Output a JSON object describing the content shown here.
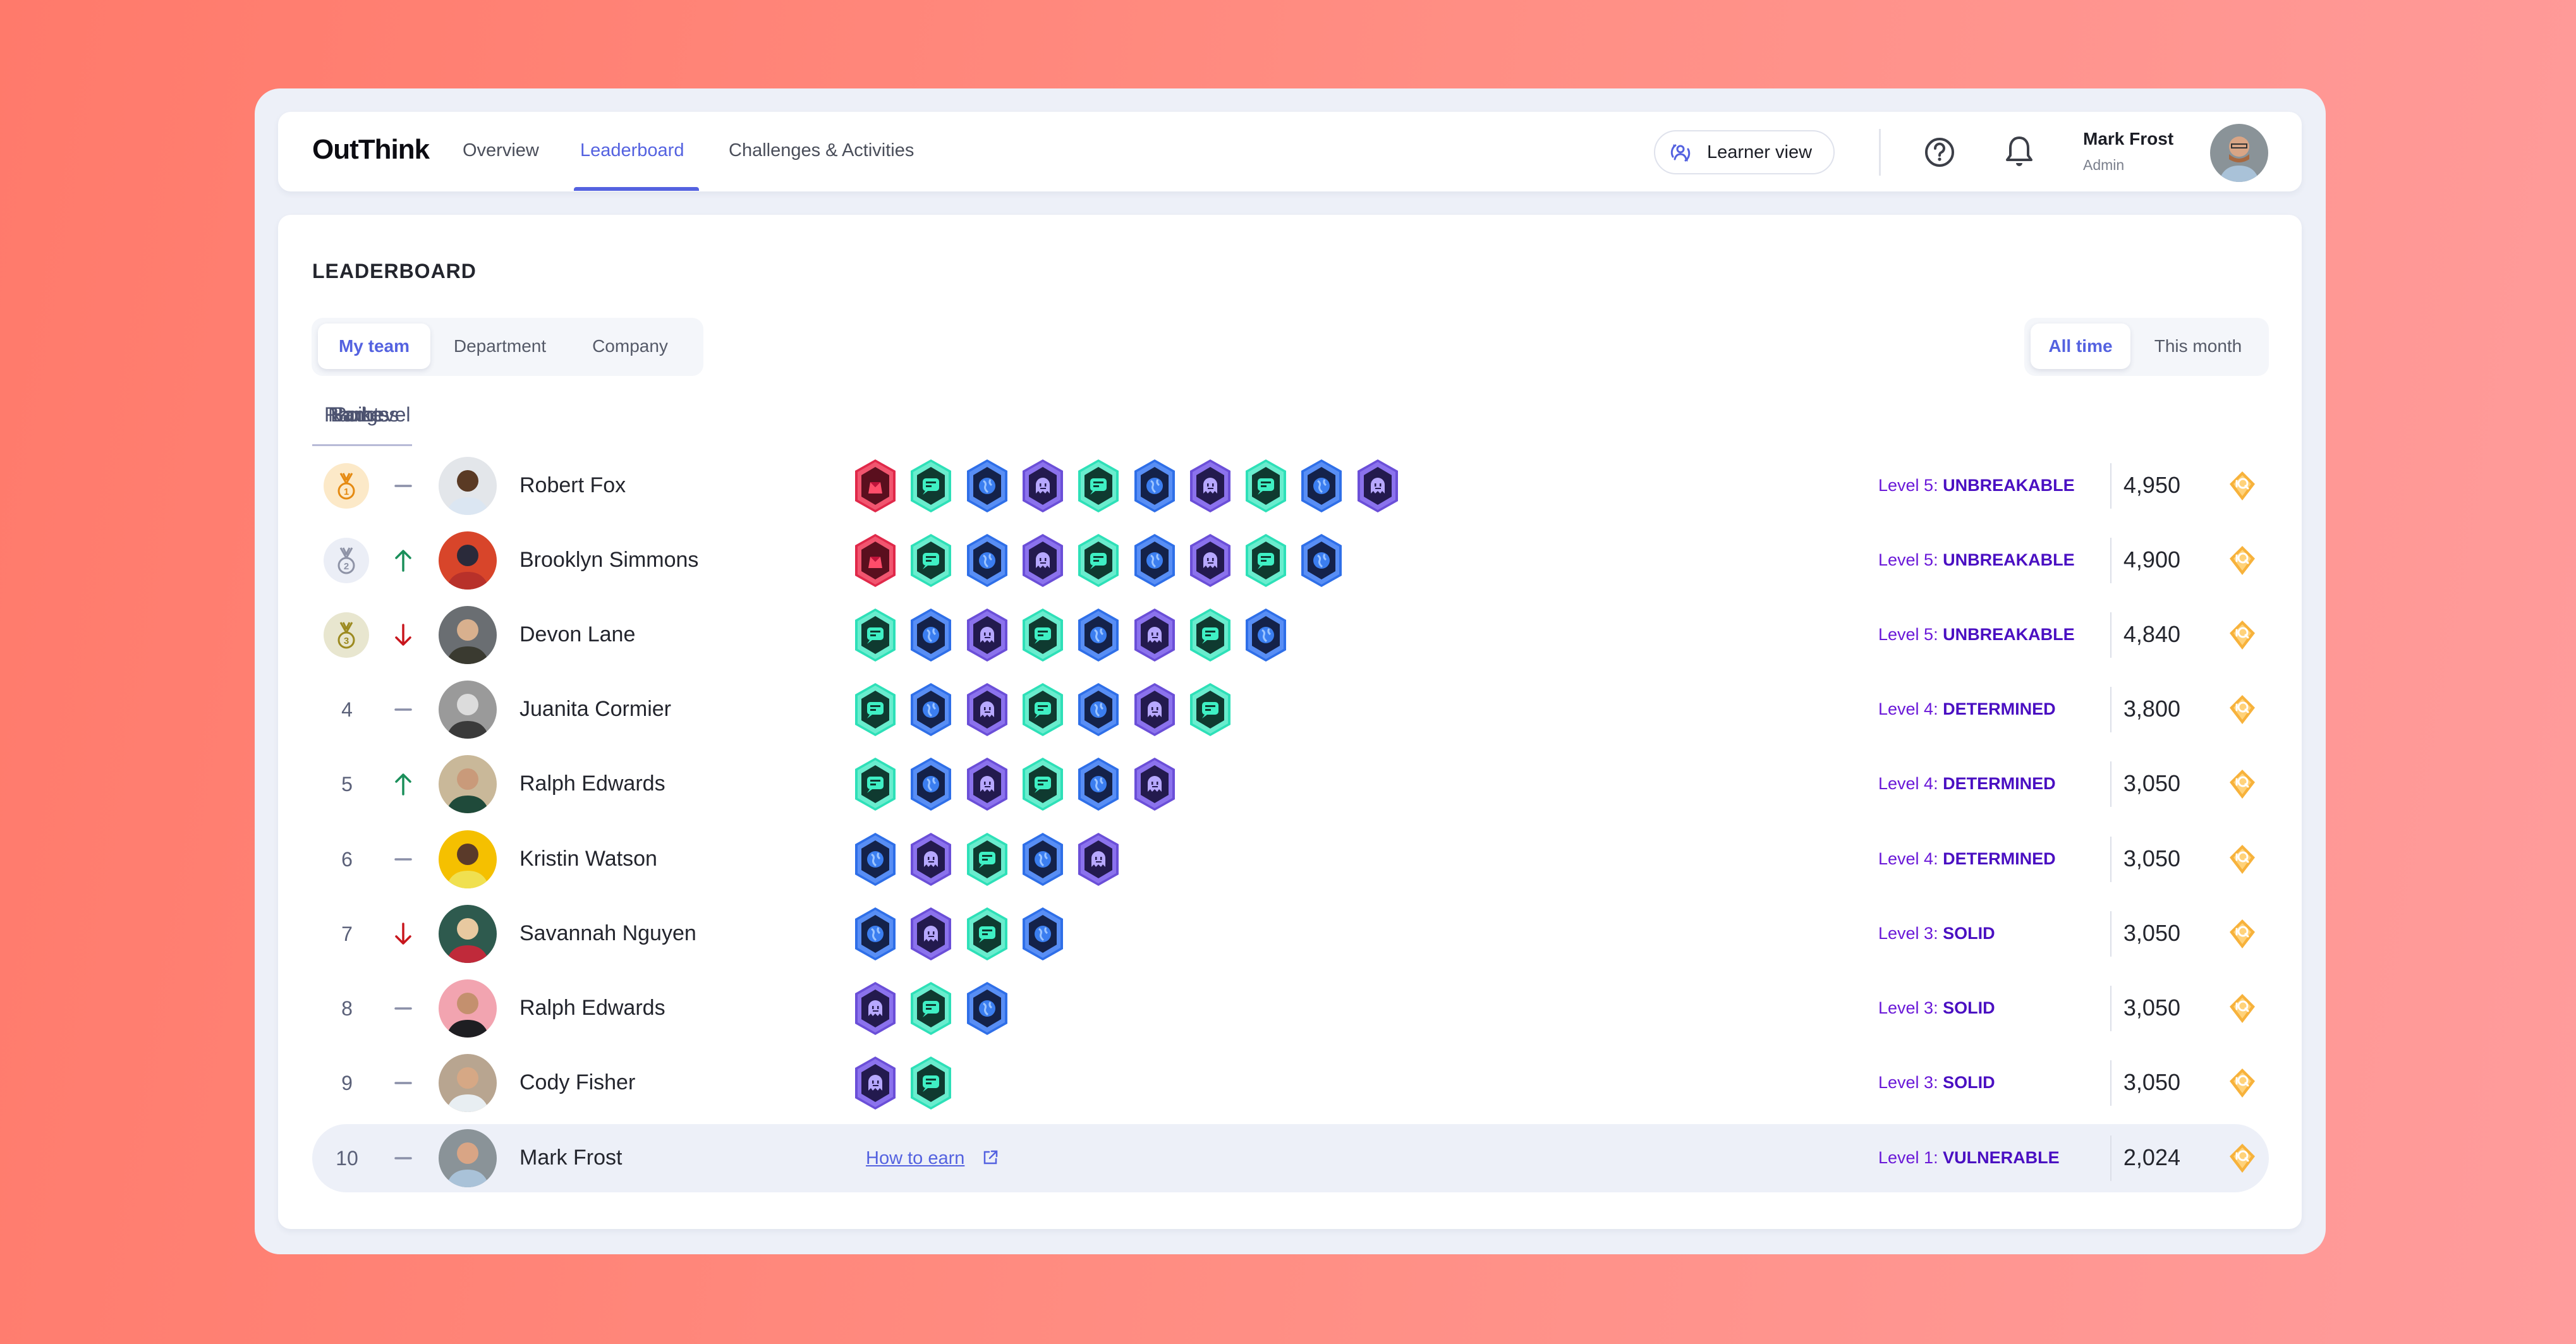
{
  "app": {
    "title": "OutThink"
  },
  "nav": {
    "items": [
      {
        "label": "Overview",
        "active": false
      },
      {
        "label": "Leaderboard",
        "active": true
      },
      {
        "label": "Challenges & Activities",
        "active": false
      }
    ]
  },
  "header": {
    "learner_view_label": "Learner view",
    "user_name": "Mark Frost",
    "user_role": "Admin"
  },
  "leaderboard": {
    "title": "LEADERBOARD",
    "scope_tabs": [
      {
        "label": "My team",
        "active": true
      },
      {
        "label": "Department",
        "active": false
      },
      {
        "label": "Company",
        "active": false
      }
    ],
    "period_tabs": [
      {
        "label": "All time",
        "active": true
      },
      {
        "label": "This month",
        "active": false
      }
    ],
    "column_headers": [
      "Rank",
      "Name",
      "Badges",
      "Points",
      "Level"
    ],
    "how_to_earn_label": "How to earn",
    "rows": [
      {
        "rank": "1",
        "medal": "gold",
        "trend": "same",
        "name": "Robert Fox",
        "badges": [
          "crown",
          "chat",
          "globe",
          "ghost",
          "chat",
          "globe",
          "ghost",
          "chat",
          "globe",
          "ghost"
        ],
        "level_prefix": "Level 5: ",
        "level_name": "UNBREAKABLE",
        "points": "4,950"
      },
      {
        "rank": "2",
        "medal": "silver",
        "trend": "up",
        "name": "Brooklyn Simmons",
        "badges": [
          "crown",
          "chat",
          "globe",
          "ghost",
          "chat",
          "globe",
          "ghost",
          "chat",
          "globe"
        ],
        "level_prefix": "Level 5: ",
        "level_name": "UNBREAKABLE",
        "points": "4,900"
      },
      {
        "rank": "3",
        "medal": "bronze",
        "trend": "down",
        "name": "Devon Lane",
        "badges": [
          "chat",
          "globe",
          "ghost",
          "chat",
          "globe",
          "ghost",
          "chat",
          "globe"
        ],
        "level_prefix": "Level 5: ",
        "level_name": "UNBREAKABLE",
        "points": "4,840"
      },
      {
        "rank": "4",
        "medal": "",
        "trend": "same",
        "name": "Juanita Cormier",
        "badges": [
          "chat",
          "globe",
          "ghost",
          "chat",
          "globe",
          "ghost",
          "chat"
        ],
        "level_prefix": "Level 4: ",
        "level_name": "DETERMINED",
        "points": "3,800"
      },
      {
        "rank": "5",
        "medal": "",
        "trend": "up",
        "name": "Ralph Edwards",
        "badges": [
          "chat",
          "globe",
          "ghost",
          "chat",
          "globe",
          "ghost"
        ],
        "level_prefix": "Level 4: ",
        "level_name": "DETERMINED",
        "points": "3,050"
      },
      {
        "rank": "6",
        "medal": "",
        "trend": "same",
        "name": "Kristin Watson",
        "badges": [
          "globe",
          "ghost",
          "chat",
          "globe",
          "ghost"
        ],
        "level_prefix": "Level 4: ",
        "level_name": "DETERMINED",
        "points": "3,050"
      },
      {
        "rank": "7",
        "medal": "",
        "trend": "down",
        "name": "Savannah Nguyen",
        "badges": [
          "globe",
          "ghost",
          "chat",
          "globe"
        ],
        "level_prefix": "Level 3: ",
        "level_name": "SOLID",
        "points": "3,050"
      },
      {
        "rank": "8",
        "medal": "",
        "trend": "same",
        "name": "Ralph Edwards",
        "badges": [
          "ghost",
          "chat",
          "globe"
        ],
        "level_prefix": "Level 3: ",
        "level_name": "SOLID",
        "points": "3,050"
      },
      {
        "rank": "9",
        "medal": "",
        "trend": "same",
        "name": "Cody Fisher",
        "badges": [
          "ghost",
          "chat"
        ],
        "level_prefix": "Level 3: ",
        "level_name": "SOLID",
        "points": "3,050"
      },
      {
        "rank": "10",
        "medal": "",
        "trend": "same",
        "name": "Mark Frost",
        "badges": [],
        "current_user": true,
        "level_prefix": "Level 1: ",
        "level_name": "VULNERABLE",
        "points": "2,024"
      }
    ]
  },
  "colors": {
    "accent": "#5462E0",
    "level_text": "#4A0FC2",
    "trend_up": "#1A8F5A",
    "trend_down": "#C8161D",
    "badge_crown": "#E0294A",
    "badge_chat": "#2EE0B8",
    "badge_globe": "#2F6FE8",
    "badge_ghost": "#6B4FD8",
    "points_icon": "#F7B23B"
  }
}
